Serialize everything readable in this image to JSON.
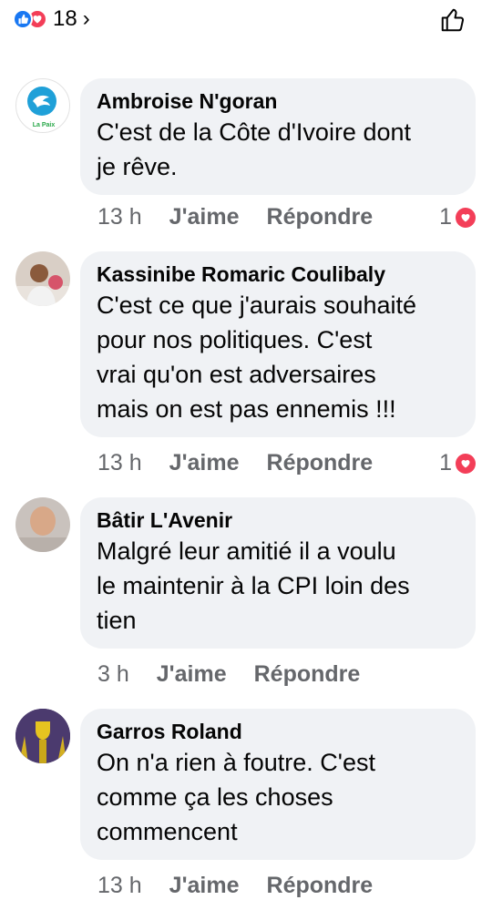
{
  "header": {
    "reaction_count": "18",
    "chevron": "›"
  },
  "comments": [
    {
      "author": "Ambroise N'goran",
      "text_lines": [
        "C'est de la Côte d'Ivoire dont",
        "je rêve."
      ],
      "time": "13 h",
      "like_label": "J'aime",
      "reply_label": "Répondre",
      "reactions": "1",
      "avatar_caption": "La Paix"
    },
    {
      "author": "Kassinibe Romaric Coulibaly",
      "text_lines": [
        "C'est ce que j'aurais souhaité",
        "pour nos politiques. C'est",
        "vrai qu'on est adversaires",
        "mais on est pas ennemis !!!"
      ],
      "time": "13 h",
      "like_label": "J'aime",
      "reply_label": "Répondre",
      "reactions": "1"
    },
    {
      "author": "Bâtir L'Avenir",
      "text_lines": [
        "Malgré leur amitié il a voulu",
        "le maintenir à la CPI loin des",
        "tien"
      ],
      "time": "3 h",
      "like_label": "J'aime",
      "reply_label": "Répondre"
    },
    {
      "author": "Garros Roland",
      "text_lines": [
        "On n'a rien à foutre. C'est",
        "comme ça les choses",
        "commencent"
      ],
      "time": "13 h",
      "like_label": "J'aime",
      "reply_label": "Répondre"
    }
  ],
  "colors": {
    "like_blue": "#1877f2",
    "love_red": "#f33e58",
    "bubble_bg": "#f0f2f5",
    "meta_gray": "#65676b"
  },
  "icons": [
    "like-reaction-icon",
    "love-reaction-icon",
    "thumbs-up-icon",
    "heart-icon"
  ]
}
